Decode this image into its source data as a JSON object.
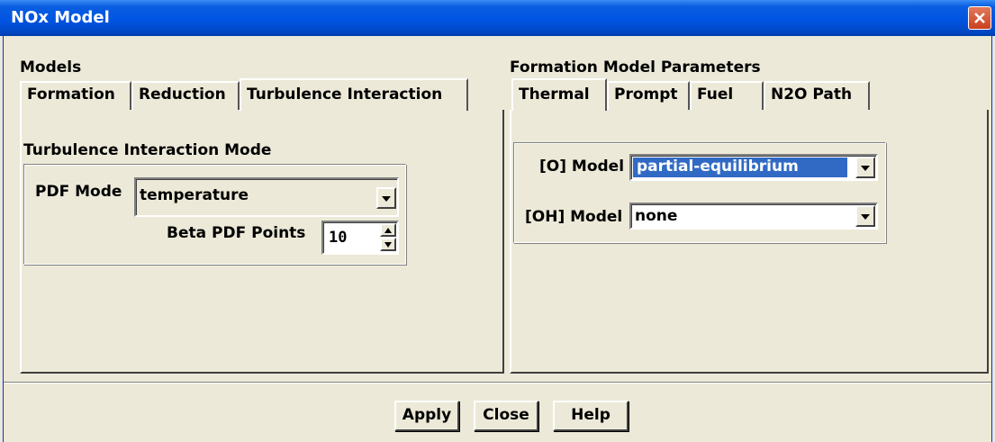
{
  "window": {
    "title": "NOx Model"
  },
  "models": {
    "label": "Models",
    "tabs": [
      {
        "label": "Formation"
      },
      {
        "label": "Reduction"
      },
      {
        "label": "Turbulence Interaction"
      }
    ],
    "active_tab": "Turbulence Interaction",
    "turbulence": {
      "section_label": "Turbulence Interaction Mode",
      "pdf_mode_label": "PDF Mode",
      "pdf_mode_value": "temperature",
      "beta_points_label": "Beta PDF Points",
      "beta_points_value": "10"
    }
  },
  "formation": {
    "label": "Formation Model Parameters",
    "tabs": [
      {
        "label": "Thermal"
      },
      {
        "label": "Prompt"
      },
      {
        "label": "Fuel"
      },
      {
        "label": "N2O Path"
      }
    ],
    "active_tab": "Thermal",
    "o_model_label": "[O] Model",
    "o_model_value": "partial-equilibrium",
    "oh_model_label": "[OH] Model",
    "oh_model_value": "none"
  },
  "buttons": {
    "apply": "Apply",
    "close": "Close",
    "help": "Help"
  },
  "colors": {
    "titlebar": "#0054e3",
    "selection": "#316ac5",
    "dialog_bg": "#ece9d8"
  }
}
